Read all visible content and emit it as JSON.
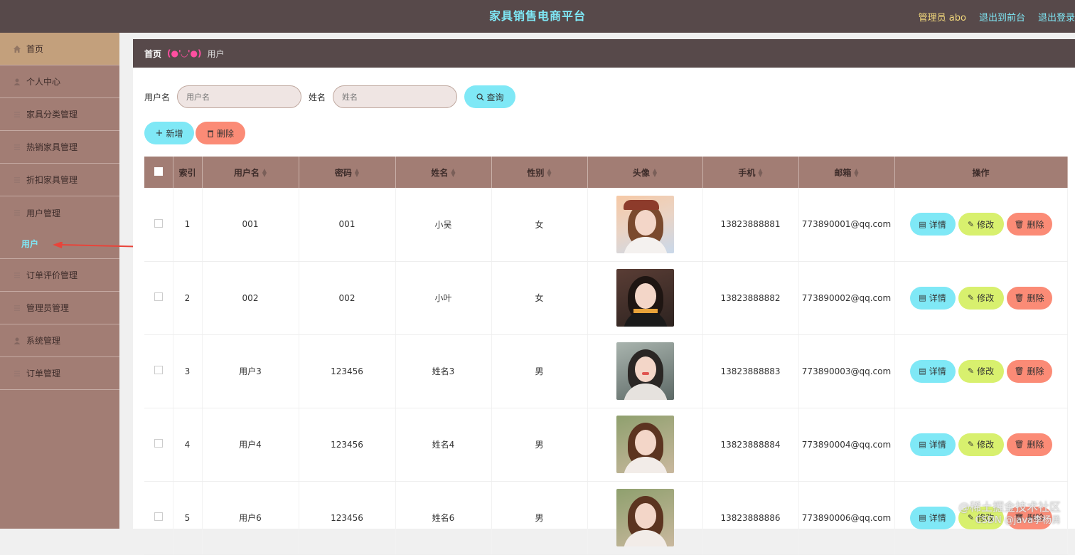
{
  "header": {
    "title": "家具销售电商平台",
    "admin_label": "管理员 abo",
    "back_to_front": "退出到前台",
    "logout": "退出登录"
  },
  "sidebar": {
    "items": [
      {
        "label": "首页",
        "icon": "home-icon"
      },
      {
        "label": "个人中心",
        "icon": "user-icon"
      },
      {
        "label": "家具分类管理",
        "icon": "list-icon"
      },
      {
        "label": "热销家具管理",
        "icon": "list-icon"
      },
      {
        "label": "折扣家具管理",
        "icon": "list-icon"
      },
      {
        "label": "用户管理",
        "icon": "list-icon"
      },
      {
        "label": "订单评价管理",
        "icon": "list-icon"
      },
      {
        "label": "管理员管理",
        "icon": "list-icon"
      },
      {
        "label": "系统管理",
        "icon": "user-icon"
      },
      {
        "label": "订单管理",
        "icon": "list-icon"
      }
    ],
    "sub_item": "用户"
  },
  "breadcrumb": {
    "home": "首页",
    "separator": "(●'◡'●)",
    "current": "用户"
  },
  "search": {
    "username_label": "用户名",
    "username_placeholder": "用户名",
    "name_label": "姓名",
    "name_placeholder": "姓名",
    "query_label": "查询"
  },
  "actions": {
    "add_label": "新增",
    "delete_label": "删除"
  },
  "table": {
    "columns": [
      "索引",
      "用户名",
      "密码",
      "姓名",
      "性别",
      "头像",
      "手机",
      "邮箱",
      "操作"
    ],
    "op_detail": "详情",
    "op_edit": "修改",
    "op_delete": "删除",
    "rows": [
      {
        "index": "1",
        "username": "001",
        "password": "001",
        "name": "小吴",
        "gender": "女",
        "phone": "13823888881",
        "email": "773890001@qq.com"
      },
      {
        "index": "2",
        "username": "002",
        "password": "002",
        "name": "小叶",
        "gender": "女",
        "phone": "13823888882",
        "email": "773890002@qq.com"
      },
      {
        "index": "3",
        "username": "用户3",
        "password": "123456",
        "name": "姓名3",
        "gender": "男",
        "phone": "13823888883",
        "email": "773890003@qq.com"
      },
      {
        "index": "4",
        "username": "用户4",
        "password": "123456",
        "name": "姓名4",
        "gender": "男",
        "phone": "13823888884",
        "email": "773890004@qq.com"
      },
      {
        "index": "5",
        "username": "用户6",
        "password": "123456",
        "name": "姓名6",
        "gender": "男",
        "phone": "13823888886",
        "email": "773890006@qq.com"
      }
    ]
  },
  "watermark": {
    "line1": "@稀土掘金技术社区",
    "line2": "CSDN @java李杨勇"
  },
  "colors": {
    "header_bg": "#57494a",
    "sidebar_bg": "#a27d74",
    "accent_cyan": "#7fe8f6",
    "edit_green": "#d8f06e",
    "delete_red": "#fb8b76"
  }
}
